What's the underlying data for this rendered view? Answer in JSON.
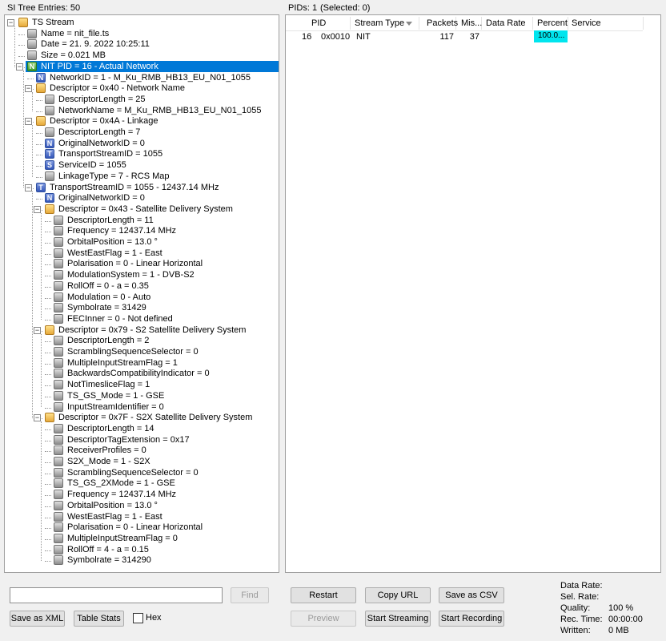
{
  "left_header": "SI Tree Entries: 50",
  "right_header": {
    "pids": "PIDs: 1",
    "selected": "(Selected: 0)"
  },
  "tree": [
    {
      "text": "TS Stream",
      "icon": "folder-icon",
      "level": 0,
      "toggle": "−"
    },
    {
      "text": "Name = nit_file.ts",
      "icon": "leaf-icon",
      "level": 1
    },
    {
      "text": "Date = 21. 9. 2022 10:25:11",
      "icon": "leaf-icon",
      "level": 1
    },
    {
      "text": "Size = 0.021 MB",
      "icon": "leaf-icon",
      "level": 1
    },
    {
      "text": "NIT PID = 16 - Actual Network",
      "icon": "nit-icon",
      "level": 1,
      "toggle": "−",
      "selected": true
    },
    {
      "text": "NetworkID = 1 - M_Ku_RMB_HB13_EU_N01_1055",
      "icon": "n-icon",
      "level": 2
    },
    {
      "text": "Descriptor = 0x40 - Network Name",
      "icon": "folder-icon",
      "level": 2,
      "toggle": "−"
    },
    {
      "text": "DescriptorLength = 25",
      "icon": "leaf-icon",
      "level": 3
    },
    {
      "text": "NetworkName = M_Ku_RMB_HB13_EU_N01_1055",
      "icon": "leaf-icon",
      "level": 3
    },
    {
      "text": "Descriptor = 0x4A - Linkage",
      "icon": "folder-icon",
      "level": 2,
      "toggle": "−"
    },
    {
      "text": "DescriptorLength = 7",
      "icon": "leaf-icon",
      "level": 3
    },
    {
      "text": "OriginalNetworkID = 0",
      "icon": "n-icon",
      "level": 3
    },
    {
      "text": "TransportStreamID = 1055",
      "icon": "t-icon",
      "level": 3
    },
    {
      "text": "ServiceID = 1055",
      "icon": "s-icon",
      "level": 3
    },
    {
      "text": "LinkageType = 7 - RCS Map",
      "icon": "leaf-icon",
      "level": 3
    },
    {
      "text": "TransportStreamID = 1055 - 12437.14 MHz",
      "icon": "t-icon",
      "level": 2,
      "toggle": "−"
    },
    {
      "text": "OriginalNetworkID = 0",
      "icon": "n-icon",
      "level": 3
    },
    {
      "text": "Descriptor = 0x43 - Satellite Delivery System",
      "icon": "folder-icon",
      "level": 3,
      "toggle": "−"
    },
    {
      "text": "DescriptorLength = 11",
      "icon": "leaf-icon",
      "level": 4
    },
    {
      "text": "Frequency = 12437.14 MHz",
      "icon": "leaf-icon",
      "level": 4
    },
    {
      "text": "OrbitalPosition = 13.0 °",
      "icon": "leaf-icon",
      "level": 4
    },
    {
      "text": "WestEastFlag = 1 - East",
      "icon": "leaf-icon",
      "level": 4
    },
    {
      "text": "Polarisation = 0 - Linear Horizontal",
      "icon": "leaf-icon",
      "level": 4
    },
    {
      "text": "ModulationSystem = 1 - DVB-S2",
      "icon": "leaf-icon",
      "level": 4
    },
    {
      "text": "RollOff = 0 - a = 0.35",
      "icon": "leaf-icon",
      "level": 4
    },
    {
      "text": "Modulation = 0 - Auto",
      "icon": "leaf-icon",
      "level": 4
    },
    {
      "text": "Symbolrate = 31429",
      "icon": "leaf-icon",
      "level": 4
    },
    {
      "text": "FECInner = 0 - Not defined",
      "icon": "leaf-icon",
      "level": 4
    },
    {
      "text": "Descriptor = 0x79 - S2 Satellite Delivery System",
      "icon": "folder-icon",
      "level": 3,
      "toggle": "−"
    },
    {
      "text": "DescriptorLength = 2",
      "icon": "leaf-icon",
      "level": 4
    },
    {
      "text": "ScramblingSequenceSelector = 0",
      "icon": "leaf-icon",
      "level": 4
    },
    {
      "text": "MultipleInputStreamFlag = 1",
      "icon": "leaf-icon",
      "level": 4
    },
    {
      "text": "BackwardsCompatibilityIndicator = 0",
      "icon": "leaf-icon",
      "level": 4
    },
    {
      "text": "NotTimesliceFlag = 1",
      "icon": "leaf-icon",
      "level": 4
    },
    {
      "text": "TS_GS_Mode = 1 - GSE",
      "icon": "leaf-icon",
      "level": 4
    },
    {
      "text": "InputStreamIdentifier = 0",
      "icon": "leaf-icon",
      "level": 4
    },
    {
      "text": "Descriptor = 0x7F - S2X Satellite Delivery System",
      "icon": "folder-icon",
      "level": 3,
      "toggle": "−"
    },
    {
      "text": "DescriptorLength = 14",
      "icon": "leaf-icon",
      "level": 4
    },
    {
      "text": "DescriptorTagExtension = 0x17",
      "icon": "leaf-icon",
      "level": 4
    },
    {
      "text": "ReceiverProfiles = 0",
      "icon": "leaf-icon",
      "level": 4
    },
    {
      "text": "S2X_Mode = 1 - S2X",
      "icon": "leaf-icon",
      "level": 4
    },
    {
      "text": "ScramblingSequenceSelector = 0",
      "icon": "leaf-icon",
      "level": 4
    },
    {
      "text": "TS_GS_2XMode = 1 - GSE",
      "icon": "leaf-icon",
      "level": 4
    },
    {
      "text": "Frequency = 12437.14 MHz",
      "icon": "leaf-icon",
      "level": 4
    },
    {
      "text": "OrbitalPosition = 13.0 °",
      "icon": "leaf-icon",
      "level": 4
    },
    {
      "text": "WestEastFlag = 1 - East",
      "icon": "leaf-icon",
      "level": 4
    },
    {
      "text": "Polarisation = 0 - Linear Horizontal",
      "icon": "leaf-icon",
      "level": 4
    },
    {
      "text": "MultipleInputStreamFlag = 0",
      "icon": "leaf-icon",
      "level": 4
    },
    {
      "text": "RollOff = 4 - a = 0.15",
      "icon": "leaf-icon",
      "level": 4
    },
    {
      "text": "Symbolrate = 314290",
      "icon": "leaf-icon",
      "level": 4
    }
  ],
  "pid_table": {
    "columns": [
      "PID",
      "Stream Type",
      "Packets",
      "Mis...",
      "Data Rate",
      "Percent",
      "Service"
    ],
    "rows": [
      {
        "pid_dec": "16",
        "pid_hex": "0x0010",
        "stream_type": "NIT",
        "packets": "117",
        "missing": "37",
        "data_rate": "",
        "percent": "100.0...",
        "service": ""
      }
    ],
    "percent_color": "#00e5ee"
  },
  "left_controls": {
    "search_value": "",
    "find_label": "Find",
    "save_xml_label": "Save as XML",
    "table_stats_label": "Table Stats",
    "hex_label": "Hex",
    "hex_checked": false
  },
  "right_controls": {
    "restart_label": "Restart",
    "copy_url_label": "Copy URL",
    "save_csv_label": "Save as CSV",
    "preview_label": "Preview",
    "start_streaming_label": "Start Streaming",
    "start_recording_label": "Start Recording"
  },
  "stats": {
    "data_rate_label": "Data Rate:",
    "data_rate_value": "",
    "sel_rate_label": "Sel. Rate:",
    "sel_rate_value": "",
    "quality_label": "Quality:",
    "quality_value": "100 %",
    "rec_time_label": "Rec. Time:",
    "rec_time_value": "00:00:00",
    "written_label": "Written:",
    "written_value": "0 MB"
  },
  "colors": {
    "selection": "#0078d7",
    "percent_fill": "#00e5ee"
  }
}
